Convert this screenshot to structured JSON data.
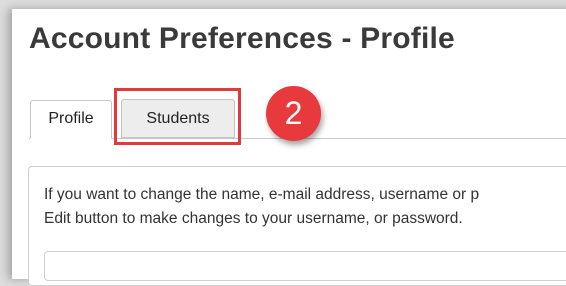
{
  "page": {
    "title": "Account Preferences - Profile"
  },
  "tabs": [
    {
      "label": "Profile",
      "active": true
    },
    {
      "label": "Students",
      "active": false
    }
  ],
  "annotation": {
    "step_number": "2",
    "highlight_color": "#e0393e",
    "badge_color": "#e8393c"
  },
  "content": {
    "line1": "If you want to change the name, e-mail address, username or p",
    "line2": "Edit button to make changes to your username, or password."
  }
}
